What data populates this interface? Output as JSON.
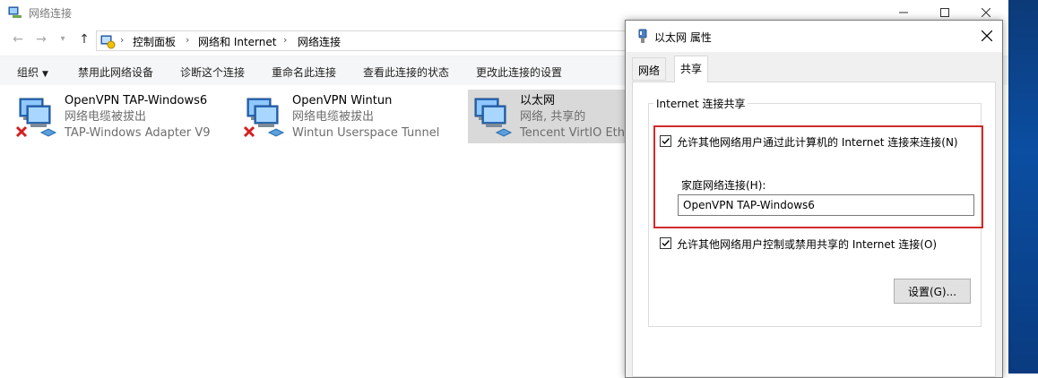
{
  "window": {
    "title": "网络连接"
  },
  "address": {
    "crumbs": [
      "控制面板",
      "网络和 Internet",
      "网络连接"
    ]
  },
  "toolbar": {
    "organize": "组织",
    "items": [
      "禁用此网络设备",
      "诊断这个连接",
      "重命名此连接",
      "查看此连接的状态",
      "更改此连接的设置"
    ]
  },
  "connections": [
    {
      "name": "OpenVPN TAP-Windows6",
      "status": "网络电缆被拔出",
      "adapter": "TAP-Windows Adapter V9",
      "disconnected": true,
      "selected": false
    },
    {
      "name": "OpenVPN Wintun",
      "status": "网络电缆被拔出",
      "adapter": "Wintun Userspace Tunnel",
      "disconnected": true,
      "selected": false
    },
    {
      "name": "以太网",
      "status": "网络, 共享的",
      "adapter": "Tencent VirtIO Ether",
      "disconnected": false,
      "selected": true
    }
  ],
  "dialog": {
    "title": "以太网 属性",
    "tabs": [
      "网络",
      "共享"
    ],
    "active_tab": "共享",
    "group_title": "Internet 连接共享",
    "allow_share_label": "允许其他网络用户通过此计算机的 Internet 连接来连接(N)",
    "allow_share_checked": true,
    "home_conn_label": "家庭网络连接(H):",
    "home_conn_value": "OpenVPN TAP-Windows6",
    "allow_control_label": "允许其他网络用户控制或禁用共享的 Internet 连接(O)",
    "allow_control_checked": true,
    "settings_button": "设置(G)..."
  },
  "colors": {
    "highlight_border": "#d12b2b",
    "disconnected_x": "#d32020",
    "selected_item_bg": "#d9d9d9"
  }
}
